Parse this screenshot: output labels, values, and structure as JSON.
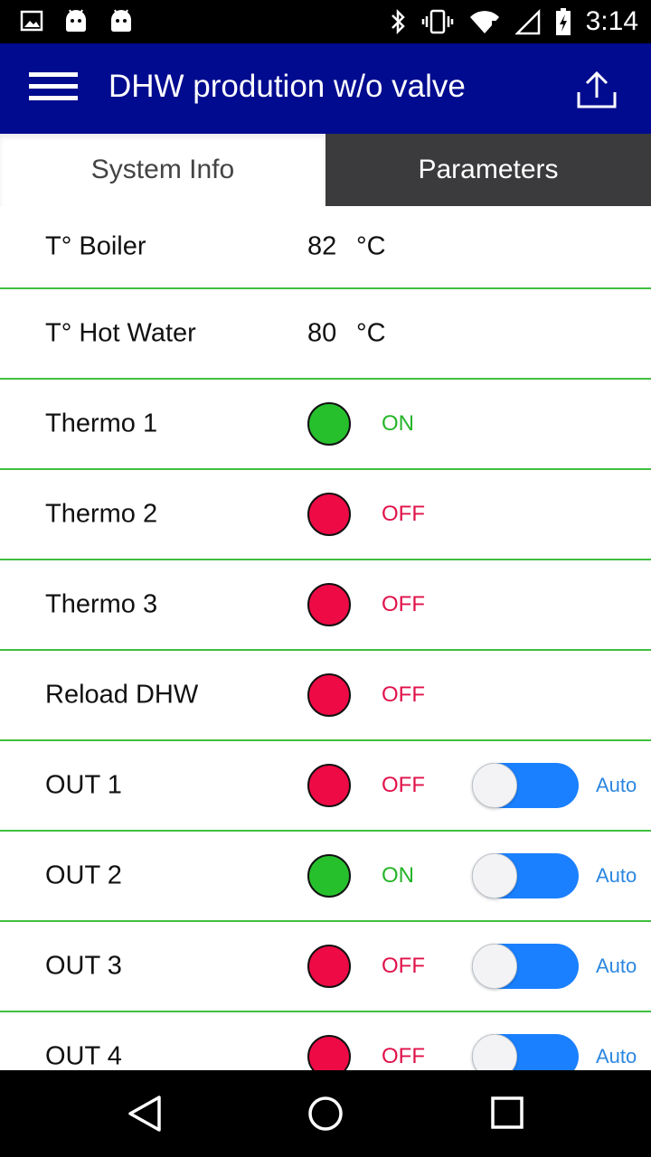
{
  "status_bar": {
    "time": "3:14",
    "left_icons": [
      "image-icon",
      "android-icon",
      "android-icon"
    ],
    "right_icons": [
      "bluetooth-icon",
      "vibrate-icon",
      "wifi-icon",
      "signal-icon",
      "battery-charging-icon"
    ]
  },
  "toolbar": {
    "title": "DHW prodution w/o valve",
    "background": "#000b8f"
  },
  "tabs": [
    {
      "label": "System Info",
      "active": true
    },
    {
      "label": "Parameters",
      "active": false
    }
  ],
  "rows": [
    {
      "label": "T° Boiler",
      "value": "82",
      "unit": "°C"
    },
    {
      "label": "T° Hot Water",
      "value": "80",
      "unit": "°C"
    },
    {
      "label": "Thermo 1",
      "state": "ON"
    },
    {
      "label": "Thermo 2",
      "state": "OFF"
    },
    {
      "label": "Thermo 3",
      "state": "OFF"
    },
    {
      "label": "Reload DHW",
      "state": "OFF"
    },
    {
      "label": "OUT 1",
      "state": "OFF",
      "mode": "Auto"
    },
    {
      "label": "OUT 2",
      "state": "ON",
      "mode": "Auto"
    },
    {
      "label": "OUT 3",
      "state": "OFF",
      "mode": "Auto"
    },
    {
      "label": "OUT 4",
      "state": "OFF",
      "mode": "Auto"
    }
  ],
  "colors": {
    "on": "#27c02d",
    "off": "#ee0a45",
    "divider": "#3fbf3f",
    "toggle": "#1a80ff",
    "auto_text": "#2b87e0"
  }
}
